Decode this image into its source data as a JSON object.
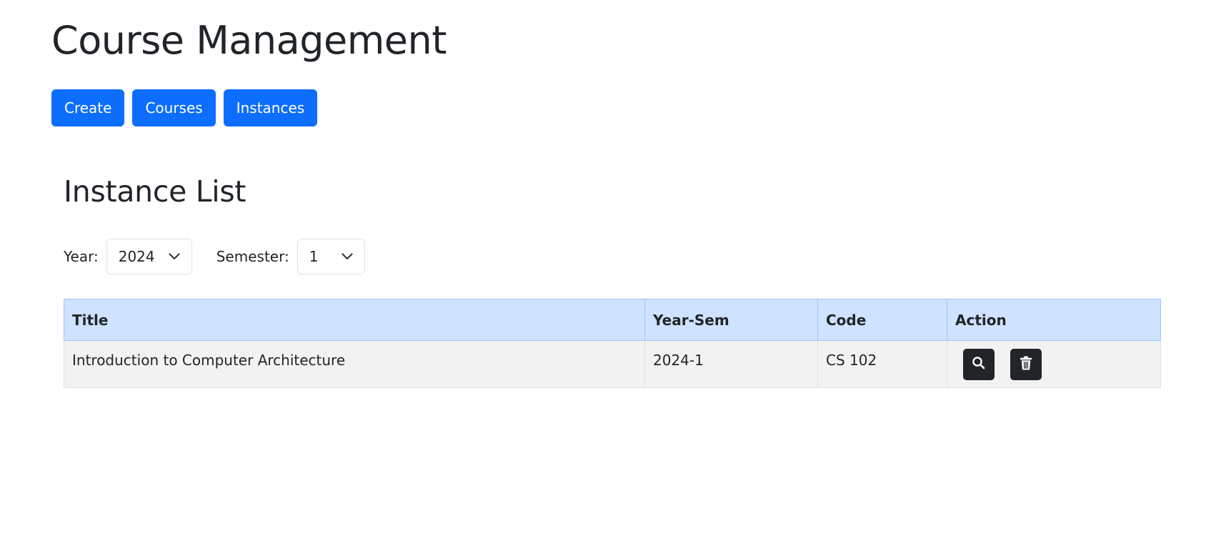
{
  "header": {
    "title": "Course Management"
  },
  "nav": {
    "create_label": "Create",
    "courses_label": "Courses",
    "instances_label": "Instances"
  },
  "section": {
    "title": "Instance List"
  },
  "filters": {
    "year_label": "Year:",
    "year_value": "2024",
    "semester_label": "Semester:",
    "semester_value": "1"
  },
  "table": {
    "columns": [
      "Title",
      "Year-Sem",
      "Code",
      "Action"
    ],
    "rows": [
      {
        "title": "Introduction to Computer Architecture",
        "year_sem": "2024-1",
        "code": "CS 102",
        "actions": [
          "search-icon",
          "trash-icon"
        ]
      }
    ]
  },
  "colors": {
    "primary": "#0d6efd",
    "table_header_bg": "#cfe2ff",
    "row_bg": "#f2f2f2",
    "dark_button": "#212529",
    "text": "#212529"
  }
}
